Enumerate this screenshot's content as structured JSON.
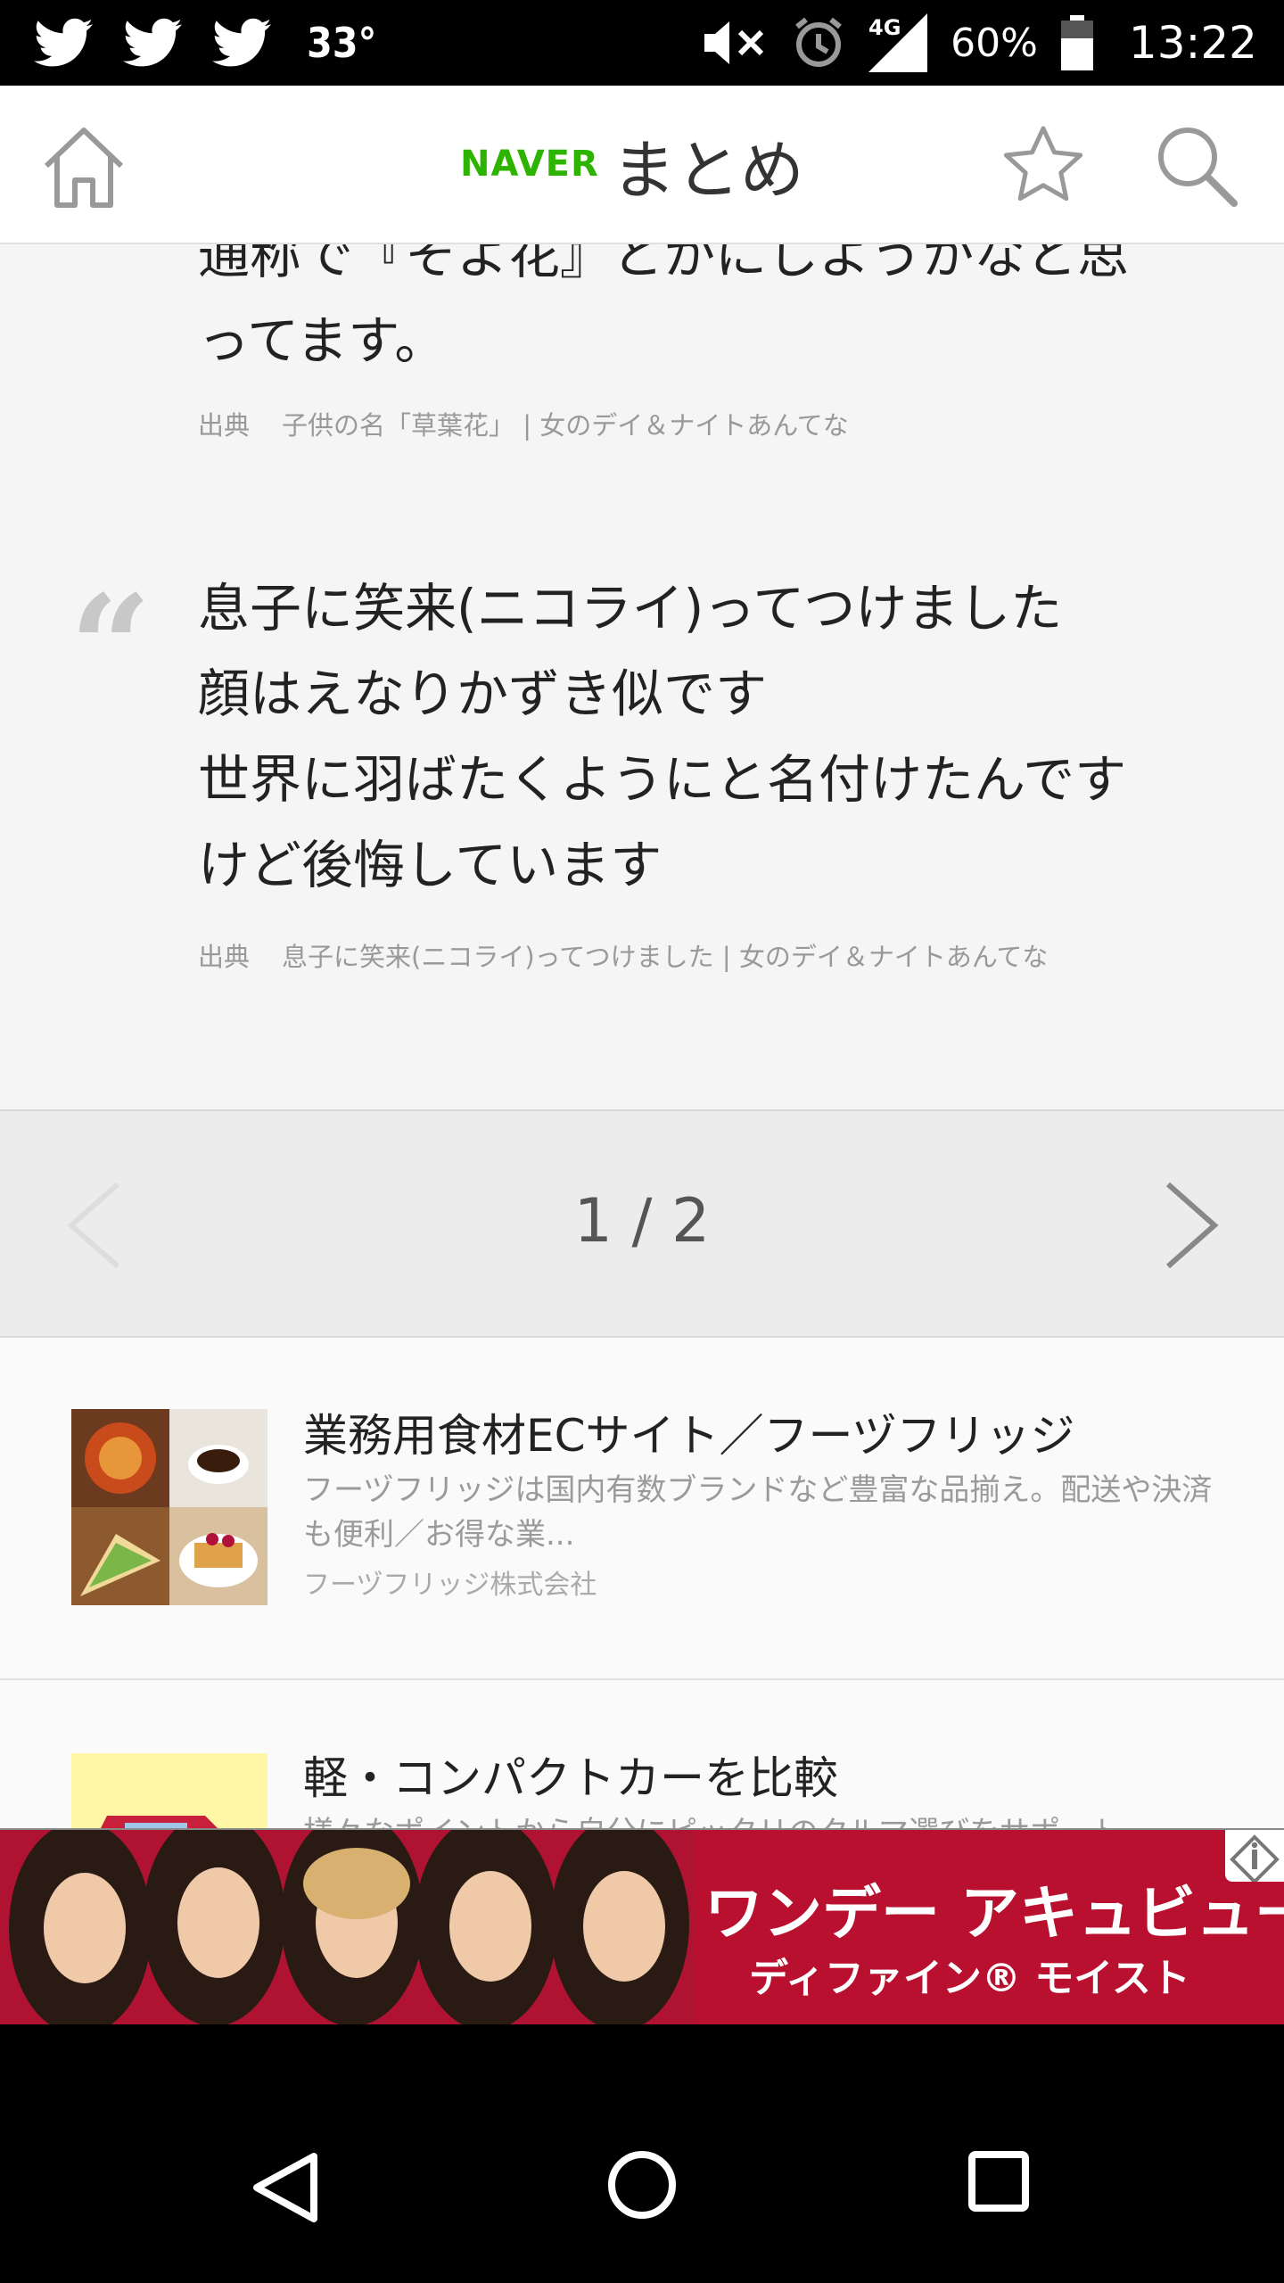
{
  "status_bar": {
    "notification_icons": [
      "twitter-icon",
      "twitter-icon",
      "twitter-icon"
    ],
    "temperature": "33°",
    "network": "4G",
    "battery": "60%",
    "time": "13:22"
  },
  "header": {
    "logo_brand": "NAVER",
    "logo_text": "まとめ"
  },
  "quotes": [
    {
      "lines": [
        "通称で『そよ花』とかにしようかなと思",
        "ってます。"
      ],
      "cite_label": "出典",
      "cite_source": "子供の名「草葉花」 | 女のデイ＆ナイトあんてな"
    },
    {
      "mark": "“",
      "lines": [
        "息子に笑来(ニコライ)ってつけました",
        "顔はえなりかずき似です",
        "世界に羽ばたくようにと名付けたんです",
        "けど後悔しています"
      ],
      "cite_label": "出典",
      "cite_source": "息子に笑来(ニコライ)ってつけました | 女のデイ＆ナイトあんてな"
    }
  ],
  "pagination": {
    "label": "1 / 2"
  },
  "ads": [
    {
      "title": "業務用食材ECサイト／フーヅフリッジ",
      "desc": "フーヅフリッジは国内有数ブランドなど豊富な品揃え。配送や決済も便利／お得な業...",
      "company": "フーヅフリッジ株式会社"
    },
    {
      "title": "軽・コンパクトカーを比較",
      "desc": "様々なポイントから自分にピッタリのクルマ選びをサポート"
    }
  ],
  "banner": {
    "line1": "ワンデー アキュビュー®",
    "line2": "ディファイン® モイスト"
  },
  "colors": {
    "naver_green": "#2db400",
    "banner_red": "#b8102e"
  }
}
